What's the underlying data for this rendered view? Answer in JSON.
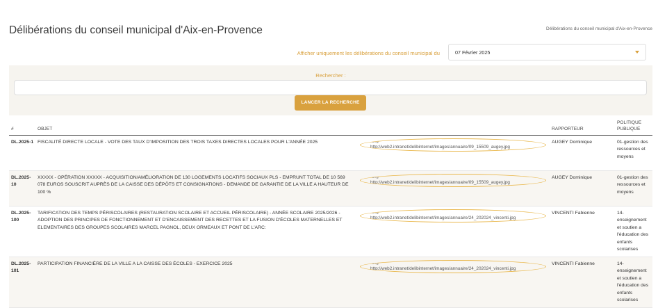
{
  "page": {
    "title": "Délibérations du conseil municipal d'Aix-en-Provence",
    "breadcrumb": "Délibérations du conseil municipal d'Aix-en-Provence"
  },
  "filter": {
    "label": "Afficher uniquement les délibérations du conseil municipal du",
    "selected_date": "07 Février 2025",
    "icon": "chevron-down-icon"
  },
  "search": {
    "label": "Rechercher :",
    "value": "",
    "button_label": "LANCER LA RECHERCHE"
  },
  "table": {
    "headers": {
      "number": "#",
      "object": "OBJET",
      "rapporteur": "RAPPORTEUR",
      "politique": "POLITIQUE PUBLIQUE"
    },
    "rows": [
      {
        "number": "DL.2025-1",
        "object": "FISCALITÉ DIRECTE LOCALE - VOTE DES TAUX D'IMPOSITION DES TROIS TAXES DIRECTES LOCALES POUR L'ANNÉE 2025",
        "doc_label": "ung",
        "doc_url": "http://web2.intranet/delibinternet/images/annuaire/09_15509_augey.jpg",
        "rapporteur": "AUGEY Dominique",
        "politique": "01-gestion des ressources et moyens"
      },
      {
        "number": "DL.2025-10",
        "object": "XXXXX - OPÉRATION XXXXX - ACQUISITION/AMÉLIORATION DE 130 LOGEMENTS LOCATIFS SOCIAUX PLS - EMPRUNT TOTAL DE 10 569 078 EUROS SOUSCRIT AUPRÈS DE LA CAISSE DES DÉPÔTS ET CONSIGNATIONS - DEMANDE DE GARANTIE DE LA VILLE A HAUTEUR DE 100 %",
        "doc_label": "ung",
        "doc_url": "http://web2.intranet/delibinternet/images/annuaire/09_15509_augey.jpg",
        "rapporteur": "AUGEY Dominique",
        "politique": "01-gestion des ressources et moyens"
      },
      {
        "number": "DL.2025-100",
        "object": "TARIFICATION DES TEMPS PÉRISCOLAIRES (RESTAURATION SCOLAIRE ET ACCUEIL PÉRISCOLAIRE) - ANNÉE SCOLAIRE 2025/2026 - ADOPTION DES PRINCIPES DE FONCTIONNEMENT ET D'ENCAISSEMENT DES RECETTES ET LA FUSION D'ÉCOLES MATERNELLES ET ELEMENTAIRES DES GROUPES SCOLAIRES MARCEL PAGNOL, DEUX ORMEAUX ET PONT DE L'ARC:",
        "doc_label": "ung",
        "doc_url": "http://web2.intranet/delibinternet/images/annuaire/24_202024_vincenti.jpg",
        "rapporteur": "VINCENTI Fabienne",
        "politique": "14-enseignement et soutien a l'éducation des enfants scolarises"
      },
      {
        "number": "DL.2025-101",
        "object": "PARTICIPATION FINANCIÈRE DE LA VILLE A LA CAISSE DES ÉCOLES - EXERCICE 2025",
        "doc_label": "ung",
        "doc_url": "http://web2.intranet/delibinternet/images/annuaire/24_202024_vincenti.jpg",
        "rapporteur": "VINCENTI Fabienne",
        "politique": "14-enseignement et soutien a l'éducation des enfants scolarises"
      }
    ]
  },
  "colors": {
    "accent": "#d9a13e",
    "panel_bg": "#f6f4ef"
  }
}
